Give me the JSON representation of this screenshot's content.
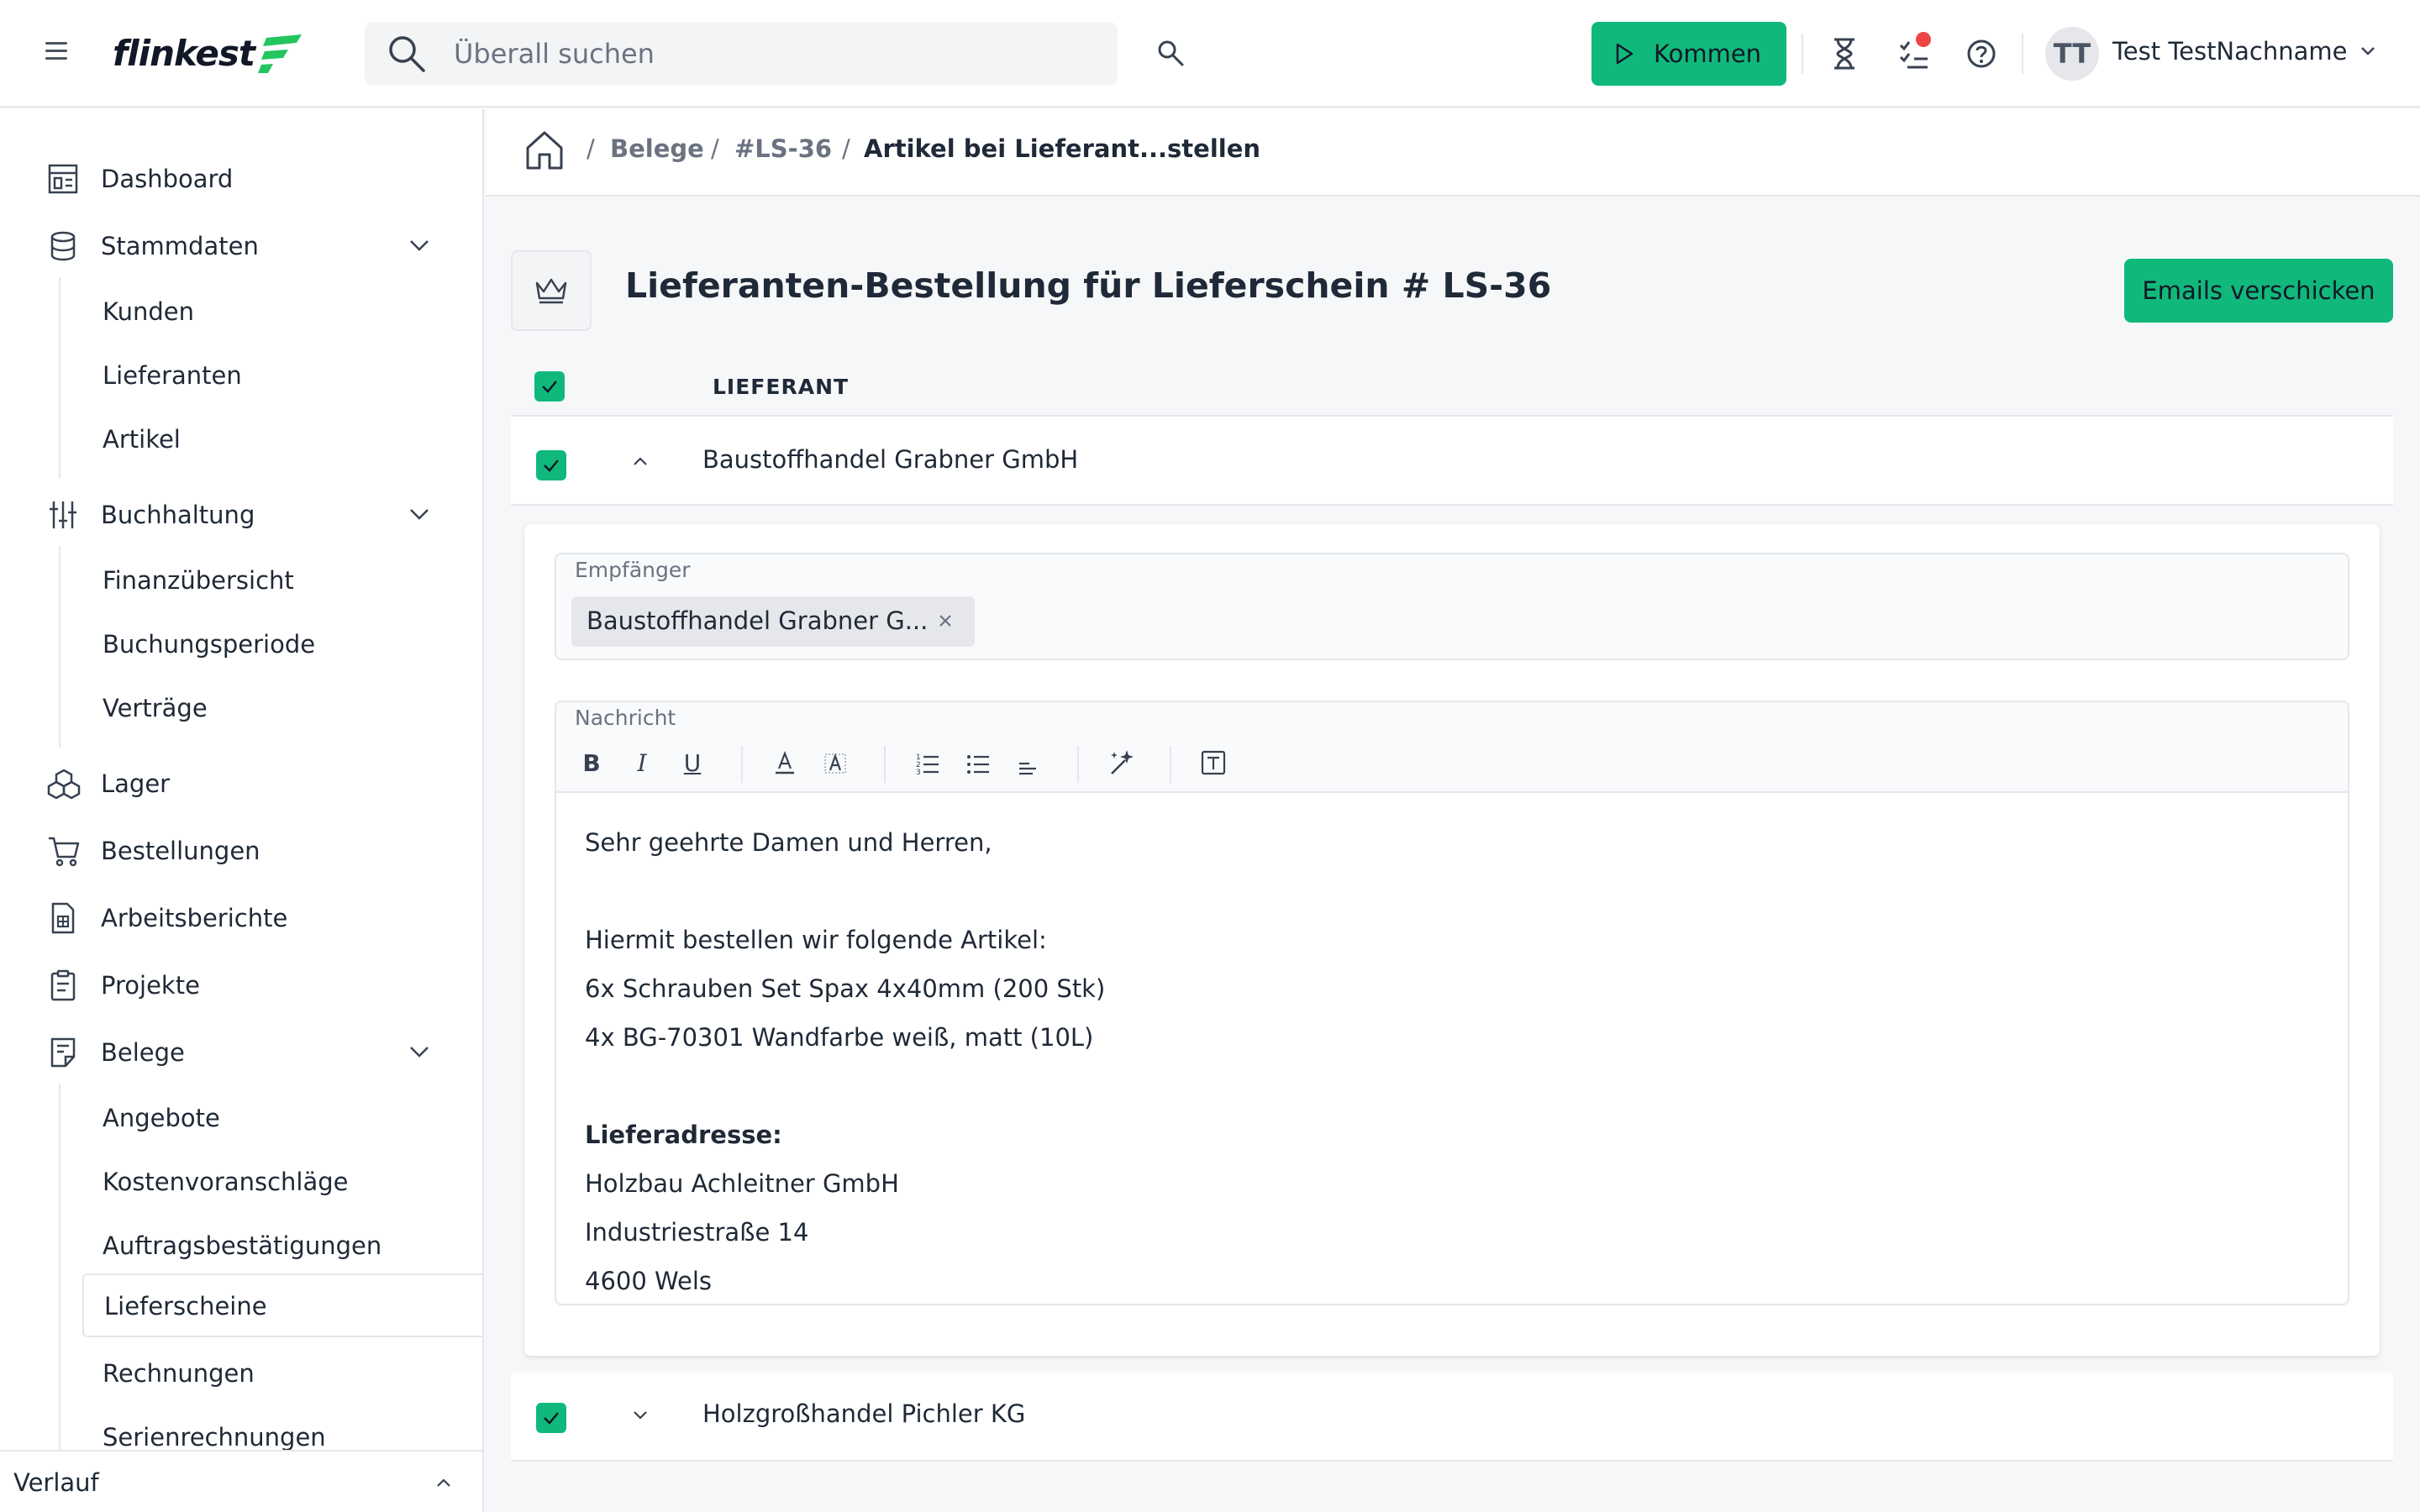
{
  "header": {
    "logo_text": "flinkest",
    "search_placeholder": "Überall suchen",
    "kommen_label": "Kommen",
    "user_initials": "TT",
    "user_name": "Test TestNachname"
  },
  "sidebar": {
    "dashboard": "Dashboard",
    "stammdaten": "Stammdaten",
    "stammdaten_items": [
      "Kunden",
      "Lieferanten",
      "Artikel"
    ],
    "buchhaltung": "Buchhaltung",
    "buchhaltung_items": [
      "Finanzübersicht",
      "Buchungsperiode",
      "Verträge"
    ],
    "lager": "Lager",
    "bestellungen": "Bestellungen",
    "arbeitsberichte": "Arbeitsberichte",
    "projekte": "Projekte",
    "belege": "Belege",
    "belege_items": [
      "Angebote",
      "Kostenvoranschläge",
      "Auftragsbestätigungen",
      "Lieferscheine",
      "Rechnungen",
      "Serienrechnungen"
    ],
    "active_item": "Lieferscheine",
    "verlauf": "Verlauf"
  },
  "breadcrumb": {
    "separator": "/",
    "items": [
      "Belege",
      "#LS-36",
      "Artikel bei Lieferant...stellen"
    ]
  },
  "page": {
    "title": "Lieferanten-Bestellung für Lieferschein # LS-36",
    "emails_button": "Emails verschicken",
    "column_header": "LIEFERANT"
  },
  "suppliers": [
    {
      "name": "Baustoffhandel Grabner GmbH",
      "checked": true,
      "expanded": true,
      "recipient_label": "Empfänger",
      "recipient_chip": "Baustoffhandel Grabner G...",
      "message_label": "Nachricht",
      "message_lines": [
        "Sehr geehrte Damen und Herren,",
        "",
        "Hiermit bestellen wir folgende Artikel:",
        "6x Schrauben Set Spax 4x40mm (200 Stk)",
        "4x BG-70301 Wandfarbe weiß, matt (10L)",
        "",
        "Lieferadresse:",
        "Holzbau Achleitner GmbH",
        "Industriestraße 14",
        "4600 Wels"
      ]
    },
    {
      "name": "Holzgroßhandel Pichler KG",
      "checked": true,
      "expanded": false
    }
  ],
  "colors": {
    "accent_green": "#10b97b",
    "notification_red": "#ef4444"
  },
  "icons": {
    "toolbar": [
      "bold-icon",
      "italic-icon",
      "underline-icon",
      "text-color-icon",
      "highlight-icon",
      "ordered-list-icon",
      "bullet-list-icon",
      "align-icon",
      "ai-magic-icon",
      "text-template-icon"
    ]
  }
}
